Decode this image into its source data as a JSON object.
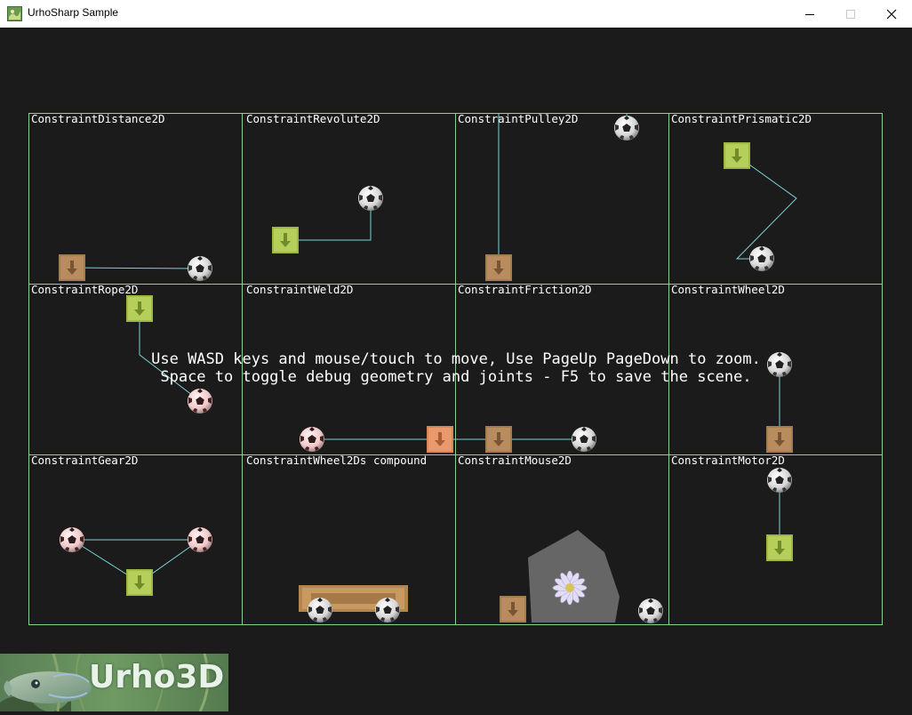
{
  "window": {
    "title": "UrhoSharp Sample",
    "controls": {
      "minimize_icon": "minimize-icon",
      "maximize_icon": "maximize-icon",
      "close_icon": "close-icon"
    }
  },
  "scene": {
    "cells": [
      {
        "label": "ConstraintDistance2D"
      },
      {
        "label": "ConstraintRevolute2D"
      },
      {
        "label": "ConstraintPulley2D"
      },
      {
        "label": "ConstraintPrismatic2D"
      },
      {
        "label": "ConstraintRope2D"
      },
      {
        "label": "ConstraintWeld2D"
      },
      {
        "label": "ConstraintFriction2D"
      },
      {
        "label": "ConstraintWheel2D"
      },
      {
        "label": "ConstraintGear2D"
      },
      {
        "label": "ConstraintWheel2Ds compound"
      },
      {
        "label": "ConstraintMouse2D"
      },
      {
        "label": "ConstraintMotor2D"
      }
    ],
    "help_lines": [
      "Use WASD keys and mouse/touch to move, Use PageUp PageDown to zoom.",
      "Space to toggle debug geometry and joints - F5 to save the scene."
    ],
    "colors": {
      "grid_line": "#8fd08f",
      "joint_line": "#7fd0d6",
      "background": "#1b1b1b"
    }
  },
  "logo": {
    "text": "Urho3D"
  }
}
